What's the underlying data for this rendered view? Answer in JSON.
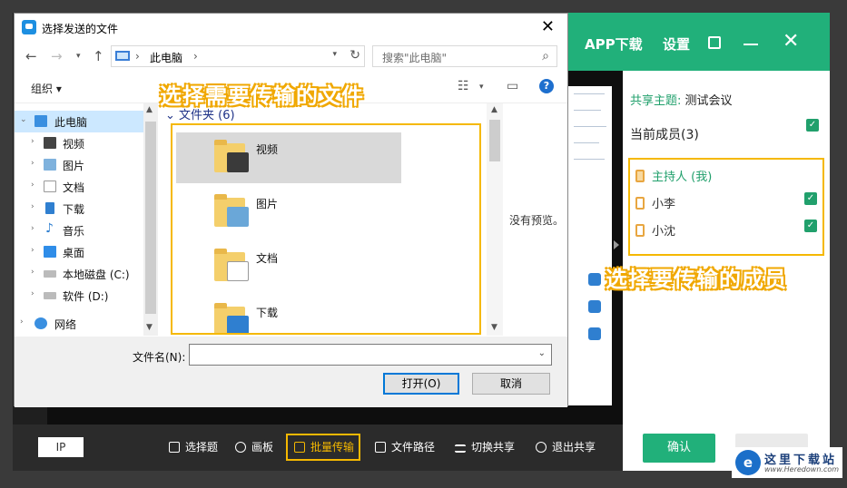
{
  "dialog": {
    "title": "选择发送的文件",
    "address": {
      "location": "此电脑"
    },
    "search_placeholder": "搜索\"此电脑\"",
    "organize_label": "组织 ▾",
    "nav_tree": [
      {
        "label": "此电脑",
        "icon": "computer-icon",
        "selected": true
      },
      {
        "label": "视频",
        "icon": "videos-folder-icon"
      },
      {
        "label": "图片",
        "icon": "pictures-folder-icon"
      },
      {
        "label": "文档",
        "icon": "documents-folder-icon"
      },
      {
        "label": "下载",
        "icon": "downloads-folder-icon"
      },
      {
        "label": "音乐",
        "icon": "music-folder-icon"
      },
      {
        "label": "桌面",
        "icon": "desktop-folder-icon"
      },
      {
        "label": "本地磁盘 (C:)",
        "icon": "drive-icon"
      },
      {
        "label": "软件 (D:)",
        "icon": "drive-icon"
      },
      {
        "label": "网络",
        "icon": "network-icon"
      }
    ],
    "group_header": "文件夹 (6)",
    "files": [
      {
        "name": "视频",
        "selected": true,
        "badge_color": "#3a3a3a"
      },
      {
        "name": "图片",
        "badge_color": "#6aa7d8"
      },
      {
        "name": "文档",
        "badge_color": "#ffffff"
      },
      {
        "name": "下载",
        "badge_color": "#2f7fd0"
      }
    ],
    "preview_text": "没有预览。",
    "filename_label": "文件名(N):",
    "filename_value": "",
    "open_label": "打开(O)",
    "cancel_label": "取消"
  },
  "annotations": {
    "select_files": "选择需要传输的文件",
    "select_members": "选择要传输的成员"
  },
  "right_panel": {
    "header": {
      "app_download": "APP下载",
      "settings": "设置"
    },
    "topic_label": "共享主题:",
    "topic_value": "测试会议",
    "members_title": "当前成员(3)",
    "members": [
      {
        "name": "主持人 (我)",
        "host": true,
        "checked": false
      },
      {
        "name": "小李",
        "host": false,
        "checked": true
      },
      {
        "name": "小沈",
        "host": false,
        "checked": true
      }
    ],
    "confirm_label": "确认"
  },
  "bottom_bar": {
    "ip_label": "IP",
    "items": [
      {
        "label": "选择题",
        "icon": "list-icon"
      },
      {
        "label": "画板",
        "icon": "palette-icon"
      },
      {
        "label": "批量传输",
        "icon": "upload-icon",
        "active": true
      },
      {
        "label": "文件路径",
        "icon": "folder-icon"
      },
      {
        "label": "切换共享",
        "icon": "switch-icon"
      },
      {
        "label": "退出共享",
        "icon": "power-icon"
      }
    ]
  },
  "watermark": {
    "logo_letter": "e",
    "title": "这里下载站",
    "url": "www.Heredown.com"
  },
  "colors": {
    "accent_green": "#21b07a",
    "highlight_yellow": "#f5b800",
    "selection_blue": "#cce8ff"
  }
}
